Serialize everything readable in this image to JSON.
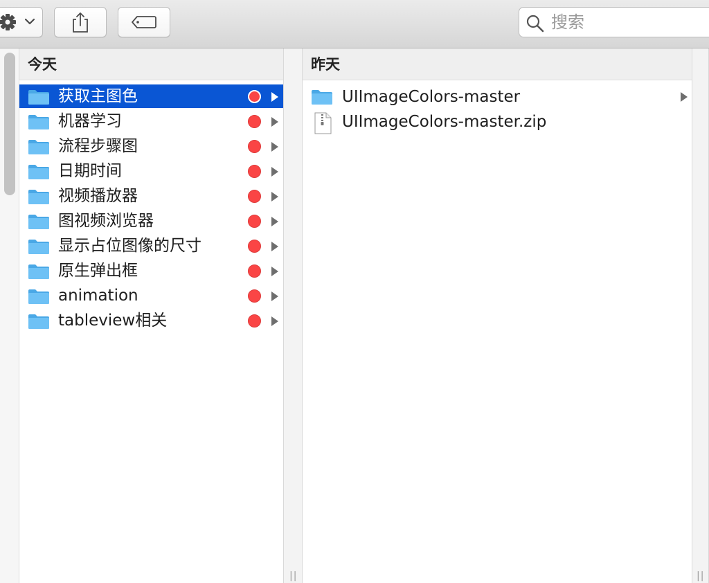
{
  "toolbar": {
    "action_icon": "gear-icon",
    "share_icon": "share-icon",
    "tag_icon": "tag-icon"
  },
  "search": {
    "placeholder": "搜索",
    "value": ""
  },
  "columns": {
    "today": {
      "header": "今天",
      "items": [
        {
          "label": "获取主图色",
          "tag_color": "#fa4545",
          "selected": true
        },
        {
          "label": "机器学习",
          "tag_color": "#fa4545"
        },
        {
          "label": "流程步骤图",
          "tag_color": "#fa4545"
        },
        {
          "label": "日期时间",
          "tag_color": "#fa4545"
        },
        {
          "label": "视频播放器",
          "tag_color": "#fa4545"
        },
        {
          "label": "图视频浏览器",
          "tag_color": "#fa4545"
        },
        {
          "label": "显示占位图像的尺寸",
          "tag_color": "#fa4545"
        },
        {
          "label": "原生弹出框",
          "tag_color": "#fa4545"
        },
        {
          "label": "animation",
          "tag_color": "#fa4545"
        },
        {
          "label": "tableview相关",
          "tag_color": "#fa4545"
        }
      ]
    },
    "yesterday": {
      "header": "昨天",
      "items": [
        {
          "label": "UIImageColors-master",
          "kind": "folder"
        },
        {
          "label": "UIImageColors-master.zip",
          "kind": "zip"
        }
      ]
    }
  },
  "colors": {
    "selection": "#0a56d4",
    "folder": "#6ec1f5",
    "tag_red": "#fa4545"
  }
}
